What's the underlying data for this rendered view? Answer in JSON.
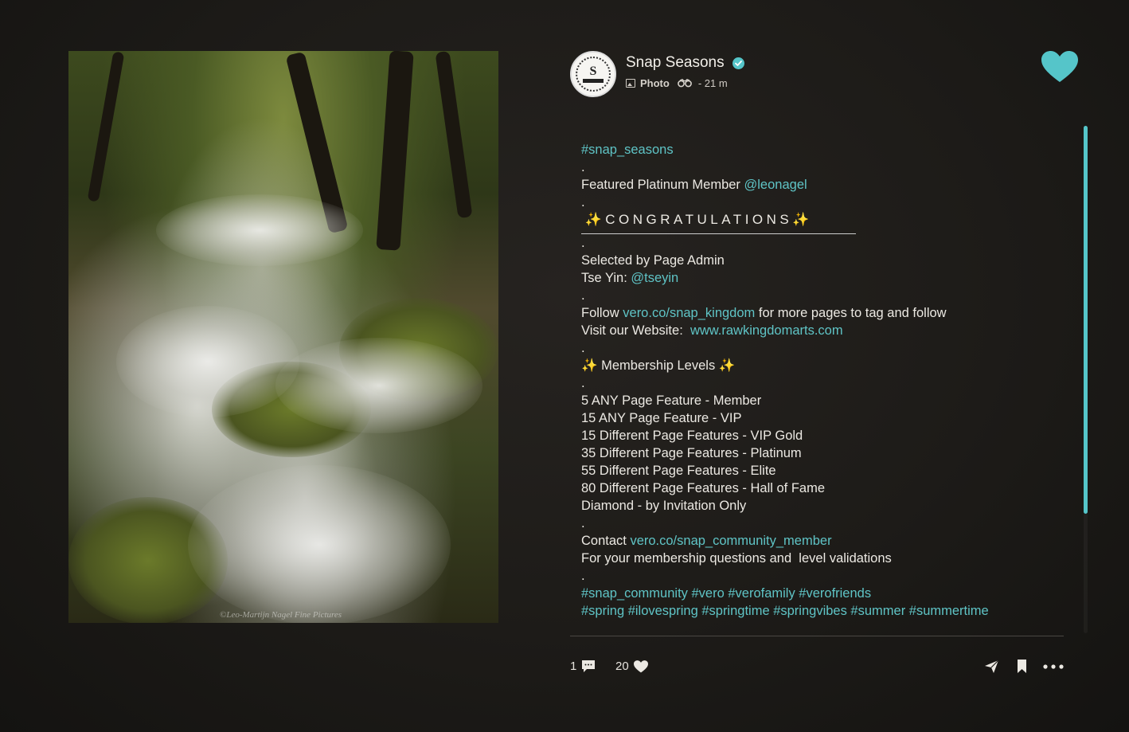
{
  "post": {
    "account_name": "Snap Seasons",
    "post_type": "Photo",
    "time_ago": "21 m",
    "separator": "-"
  },
  "photo": {
    "watermark": "©Leo-Martijn Nagel Fine Pictures"
  },
  "caption": {
    "hashtag_top": "#snap_seasons",
    "dot": ".",
    "featured_prefix": "Featured Platinum Member ",
    "featured_member": "@leonagel",
    "congrats": "✨CONGRATULATIONS✨",
    "selected_by": "Selected by Page Admin",
    "admin_prefix": "Tse Yin: ",
    "admin_handle": "@tseyin",
    "follow_prefix": "Follow ",
    "follow_link": "vero.co/snap_kingdom",
    "follow_suffix": " for more pages to tag and follow",
    "website_prefix": "Visit our Website:  ",
    "website_link": "www.rawkingdomarts.com",
    "membership_title": "✨ Membership Levels ✨",
    "levels": [
      "5 ANY Page Feature - Member",
      "15 ANY Page Feature - VIP",
      "15 Different Page Features - VIP Gold",
      "35 Different Page Features - Platinum",
      "55 Different Page Features - Elite",
      "80 Different Page Features - Hall of Fame",
      "Diamond - by Invitation Only"
    ],
    "contact_prefix": "Contact ",
    "contact_link": "vero.co/snap_community_member",
    "contact_note": "For your membership questions and  level validations",
    "hashtags_line1": "#snap_community #vero #verofamily #verofriends",
    "hashtags_line2": "#spring #ilovespring #springtime #springvibes #summer #summertime"
  },
  "footer": {
    "comment_count": "1",
    "like_count": "20"
  },
  "colors": {
    "accent": "#55c5c9",
    "link": "#5fc4c6",
    "background": "#1d1b18"
  },
  "icons": {
    "like_big": "heart-icon",
    "verified": "verified-check-icon",
    "comments": "comment-bubble-icon",
    "likes": "heart-icon",
    "share": "send-icon",
    "save": "bookmark-icon",
    "more": "more-dots-icon"
  }
}
